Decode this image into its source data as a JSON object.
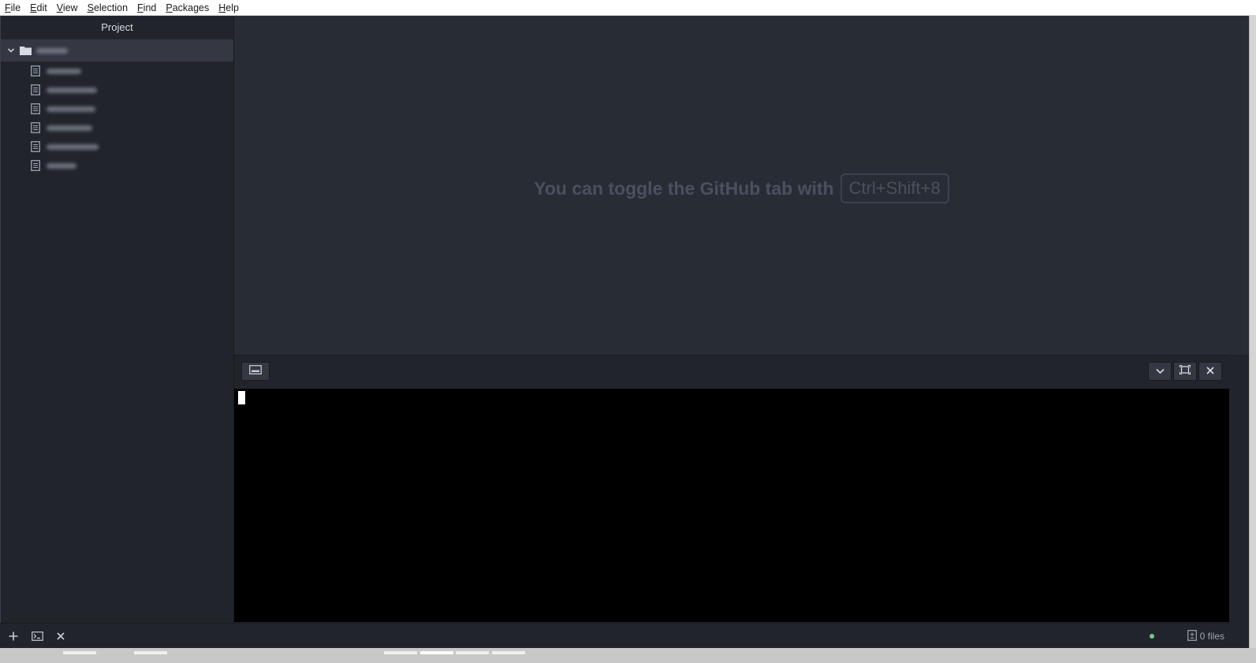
{
  "menu": {
    "items": [
      {
        "label": "File",
        "mnemonic": "F",
        "rest": "ile"
      },
      {
        "label": "Edit",
        "mnemonic": "E",
        "rest": "dit"
      },
      {
        "label": "View",
        "mnemonic": "V",
        "rest": "iew"
      },
      {
        "label": "Selection",
        "mnemonic": "S",
        "rest": "election"
      },
      {
        "label": "Find",
        "mnemonic": "F",
        "rest": "ind"
      },
      {
        "label": "Packages",
        "mnemonic": "P",
        "rest": "ackages"
      },
      {
        "label": "Help",
        "mnemonic": "H",
        "rest": "elp"
      }
    ]
  },
  "sidebar": {
    "title": "Project",
    "root": {
      "icon": "folder-icon",
      "expanded": true
    },
    "files": [
      {
        "icon": "file-text-icon"
      },
      {
        "icon": "file-text-icon"
      },
      {
        "icon": "file-text-icon"
      },
      {
        "icon": "file-text-icon"
      },
      {
        "icon": "file-text-icon"
      },
      {
        "icon": "file-text-icon"
      }
    ]
  },
  "main": {
    "hint_text": "You can toggle the GitHub tab with",
    "hint_shortcut": "Ctrl+Shift+8"
  },
  "terminal": {
    "toolbar": {
      "left_icon": "terminal-window-icon",
      "right_icons": [
        "chevron-down-icon",
        "maximize-icon",
        "close-icon"
      ]
    }
  },
  "statusbar": {
    "left_icons": [
      "plus-icon",
      "terminal-icon",
      "close-icon"
    ],
    "files_label": "0 files",
    "status_dot_color": "#73c990"
  },
  "colors": {
    "sidebar_bg": "#21252b",
    "editor_bg": "#282c34",
    "terminal_bg": "#000000",
    "selected_row": "#333842"
  }
}
